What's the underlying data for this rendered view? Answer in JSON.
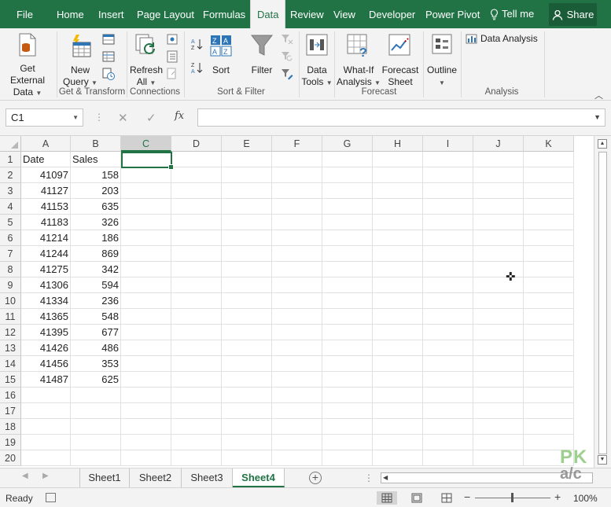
{
  "ribbon_tabs": [
    {
      "label": "File",
      "active": false
    },
    {
      "label": "Home",
      "active": false
    },
    {
      "label": "Insert",
      "active": false
    },
    {
      "label": "Page Layout",
      "active": false
    },
    {
      "label": "Formulas",
      "active": false
    },
    {
      "label": "Data",
      "active": true
    },
    {
      "label": "Review",
      "active": false
    },
    {
      "label": "View",
      "active": false
    },
    {
      "label": "Developer",
      "active": false
    },
    {
      "label": "Power Pivot",
      "active": false
    }
  ],
  "tell_me": "Tell me",
  "share": "Share",
  "ribbon": {
    "get_external_data": {
      "line1": "Get External",
      "line2": "Data"
    },
    "new_query": {
      "line1": "New",
      "line2": "Query"
    },
    "refresh_all": {
      "line1": "Refresh",
      "line2": "All"
    },
    "sort": "Sort",
    "filter": "Filter",
    "data_tools": {
      "line1": "Data",
      "line2": "Tools"
    },
    "what_if": {
      "line1": "What-If",
      "line2": "Analysis"
    },
    "forecast_sheet": {
      "line1": "Forecast",
      "line2": "Sheet"
    },
    "outline": "Outline",
    "data_analysis": "Data Analysis",
    "groups": {
      "get_transform": "Get & Transform",
      "connections": "Connections",
      "sort_filter": "Sort & Filter",
      "forecast": "Forecast",
      "analysis": "Analysis"
    }
  },
  "formula_bar": {
    "name_box": "C1",
    "fx": "fx",
    "formula": ""
  },
  "columns": [
    "A",
    "B",
    "C",
    "D",
    "E",
    "F",
    "G",
    "H",
    "I",
    "J",
    "K"
  ],
  "selected_column": "C",
  "rows": [
    [
      "Date",
      "Sales"
    ],
    [
      "41097",
      "158"
    ],
    [
      "41127",
      "203"
    ],
    [
      "41153",
      "635"
    ],
    [
      "41183",
      "326"
    ],
    [
      "41214",
      "186"
    ],
    [
      "41244",
      "869"
    ],
    [
      "41275",
      "342"
    ],
    [
      "41306",
      "594"
    ],
    [
      "41334",
      "236"
    ],
    [
      "41365",
      "548"
    ],
    [
      "41395",
      "677"
    ],
    [
      "41426",
      "486"
    ],
    [
      "41456",
      "353"
    ],
    [
      "41487",
      "625"
    ],
    [
      "",
      ""
    ],
    [
      "",
      ""
    ],
    [
      "",
      ""
    ],
    [
      "",
      ""
    ],
    [
      "",
      ""
    ]
  ],
  "sheets": [
    {
      "label": "Sheet1",
      "active": false
    },
    {
      "label": "Sheet2",
      "active": false
    },
    {
      "label": "Sheet3",
      "active": false
    },
    {
      "label": "Sheet4",
      "active": true
    }
  ],
  "status": {
    "ready": "Ready",
    "zoom": "100%"
  },
  "watermark": {
    "line1": "PK",
    "line2": "a/c"
  },
  "colors": {
    "accent": "#217346",
    "ribbon_bg": "#f3f3f3"
  }
}
